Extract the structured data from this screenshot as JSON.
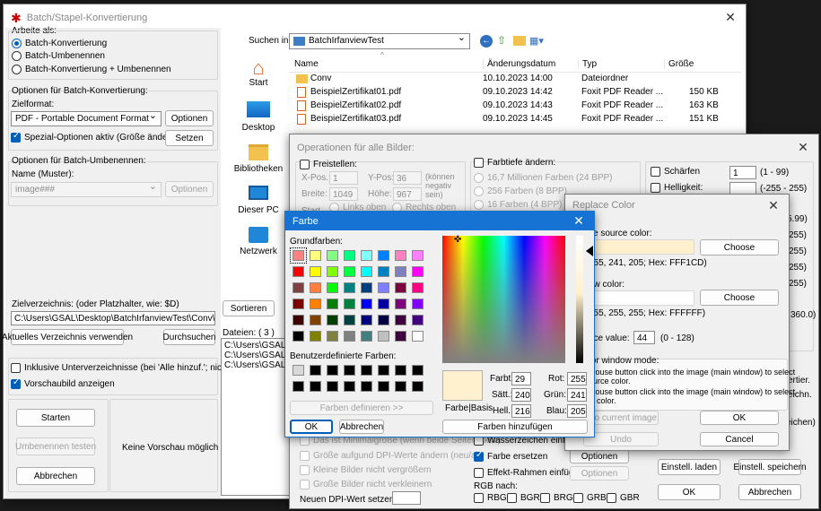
{
  "main": {
    "title": "Batch/Stapel-Konvertierung",
    "work_as": "Arbeite als:",
    "mode_options": [
      "Batch-Konvertierung",
      "Batch-Umbenennen",
      "Batch-Konvertierung + Umbenennen"
    ],
    "conv_group": "Optionen für Batch-Konvertierung:",
    "target_format_label": "Zielformat:",
    "target_format_value": "PDF - Portable Document Format",
    "options_btn": "Optionen",
    "special_options": "Spezial-Optionen aktiv (Größe ändern etc.)",
    "set_btn": "Setzen",
    "rename_group": "Optionen für Batch-Umbenennen:",
    "name_pattern_label": "Name (Muster):",
    "name_pattern_value": "image###",
    "rename_options_btn": "Optionen",
    "target_dir_label": "Zielverzeichnis: (oder Platzhalter, wie: $D)",
    "target_dir_value": "C:\\Users\\GSAL\\Desktop\\BatchIrfanviewTest\\Conv\\",
    "use_current_btn": "Aktuelles Verzeichnis verwenden",
    "browse_btn": "Durchsuchen",
    "include_subdirs": "Inklusive Unterverzeichnisse (bei 'Alle hinzuf.'; nicht gesp.)",
    "show_preview": "Vorschaubild anzeigen",
    "start_btn": "Starten",
    "test_rename_btn": "Umbenennen testen",
    "cancel_btn": "Abbrechen",
    "no_preview": "Keine Vorschau möglich !",
    "sort_btn": "Sortieren",
    "files_label": "Dateien:",
    "files_count": "( 3 )",
    "file_list": [
      "C:\\Users\\GSAL\\De",
      "C:\\Users\\GSAL\\De",
      "C:\\Users\\GSAL\\De"
    ]
  },
  "browser": {
    "search_in_label": "Suchen in:",
    "folder": "BatchIrfanviewTest",
    "places": [
      "Start",
      "Desktop",
      "Bibliotheken",
      "Dieser PC",
      "Netzwerk"
    ],
    "columns": [
      "Name",
      "Änderungsdatum",
      "Typ",
      "Größe"
    ],
    "rows": [
      {
        "name": "Conv",
        "date": "10.10.2023 14:00",
        "type": "Dateiordner",
        "size": ""
      },
      {
        "name": "BeispielZertifikat01.pdf",
        "date": "09.10.2023 14:42",
        "type": "Foxit PDF Reader ...",
        "size": "150 KB"
      },
      {
        "name": "BeispielZertifikat02.pdf",
        "date": "09.10.2023 14:43",
        "type": "Foxit PDF Reader ...",
        "size": "163 KB"
      },
      {
        "name": "BeispielZertifikat03.pdf",
        "date": "09.10.2023 14:45",
        "type": "Foxit PDF Reader ...",
        "size": "151 KB"
      }
    ]
  },
  "ops": {
    "title": "Operationen für alle Bilder:",
    "crop": "Freistellen:",
    "xpos": "X-Pos.:",
    "xpos_v": "1",
    "ypos": "Y-Pos:",
    "ypos_v": "36",
    "neg": "(können negativ sein)",
    "width": "Breite:",
    "width_v": "1049",
    "height": "Höhe:",
    "height_v": "967",
    "start": "Start",
    "top_left": "Links oben",
    "top_right": "Rechts oben",
    "depth": "Farbtiefe ändern:",
    "depth_opts": [
      "16,7 Millionen Farben (24 BPP)",
      "256 Farben (8 BPP)",
      "16 Farben (4 BPP)"
    ],
    "sharpen": "Schärfen",
    "sharpen_v": "1",
    "sharpen_r": "(1 - 99)",
    "brightness": "Helligkeit:",
    "brightness_r": "(-255 - 255)",
    "right_vals": [
      "5.99)",
      "255)",
      "255)",
      "255)",
      "255)",
      "360.0)"
    ],
    "right_bits": [
      "ertier.",
      "eichn.",
      "eichen)"
    ],
    "left_bottom": [
      "Das ist Minimalgröße (wenn beide Seiten aktiv)",
      "Größe aufgund DPI-Werte ändern (neu/alt)",
      "Kleine Bilder nicht vergrößern",
      "Große Bilder nicht verkleinern"
    ],
    "dpi_label": "Neuen DPI-Wert setzen:",
    "watermark": "Wasserzeichen einfüg.",
    "replace_color": "Farbe ersetzen",
    "replace_opts": "Optionen",
    "frame": "Effekt-Rahmen einfüg.",
    "frame_opts": "Optionen",
    "rgb_label": "RGB nach:",
    "rgb_opts": [
      "RBG",
      "BGR",
      "BRG",
      "GRB",
      "GBR"
    ],
    "load_btn": "Einstell. laden",
    "save_btn": "Einstell. speichern",
    "ok_btn": "OK",
    "cancel_btn": "Abbrechen"
  },
  "replace": {
    "title": "Replace Color",
    "source_label": "ce source color:",
    "source_val": "255, 241, 205; Hex: FFF1CD)",
    "choose1": "Choose",
    "new_label": "ew color:",
    "new_val": "255, 255, 255; Hex: FFFFFF)",
    "choose2": "Choose",
    "tol_label": "nce value:",
    "tol_val": "44",
    "tol_range": "(0 - 128)",
    "win_mode": "for window mode:",
    "info1": "mouse button click into the image (main window) to select",
    "info1b": "ource color.",
    "info2": "mouse button click into the image (main window) to select",
    "info2b": "w color.",
    "apply_btn": "y to current image",
    "undo_btn": "Undo",
    "ok_btn": "OK",
    "cancel_btn": "Cancel"
  },
  "color": {
    "title": "Farbe",
    "basic_label": "Grundfarben:",
    "custom_label": "Benutzerdefinierte Farben:",
    "define_btn": "Farben definieren >>",
    "ok_btn": "OK",
    "cancel_btn": "Abbrechen",
    "add_btn": "Farben hinzufügen",
    "preview_label": "Farbe|Basis",
    "hue_l": "Farbt.:",
    "hue": "29",
    "sat_l": "Sätt.:",
    "sat": "240",
    "lum_l": "Hell.:",
    "lum": "216",
    "red_l": "Rot:",
    "red": "255",
    "green_l": "Grün:",
    "green": "241",
    "blue_l": "Blau:",
    "blue": "205",
    "selected": "#fff1cd",
    "basic_colors": [
      "#ff8080",
      "#ffff80",
      "#80ff80",
      "#00ff80",
      "#80ffff",
      "#0080ff",
      "#ff80c0",
      "#ff80ff",
      "#ff0000",
      "#ffff00",
      "#80ff00",
      "#00ff40",
      "#00ffff",
      "#0080c0",
      "#8080c0",
      "#ff00ff",
      "#804040",
      "#ff8040",
      "#00ff00",
      "#008080",
      "#004080",
      "#8080ff",
      "#800040",
      "#ff0080",
      "#800000",
      "#ff8000",
      "#008000",
      "#008040",
      "#0000ff",
      "#0000a0",
      "#800080",
      "#8000ff",
      "#400000",
      "#804000",
      "#004000",
      "#004040",
      "#000080",
      "#000040",
      "#400040",
      "#400080",
      "#000000",
      "#808000",
      "#808040",
      "#808080",
      "#408080",
      "#c0c0c0",
      "#400040",
      "#ffffff"
    ]
  }
}
